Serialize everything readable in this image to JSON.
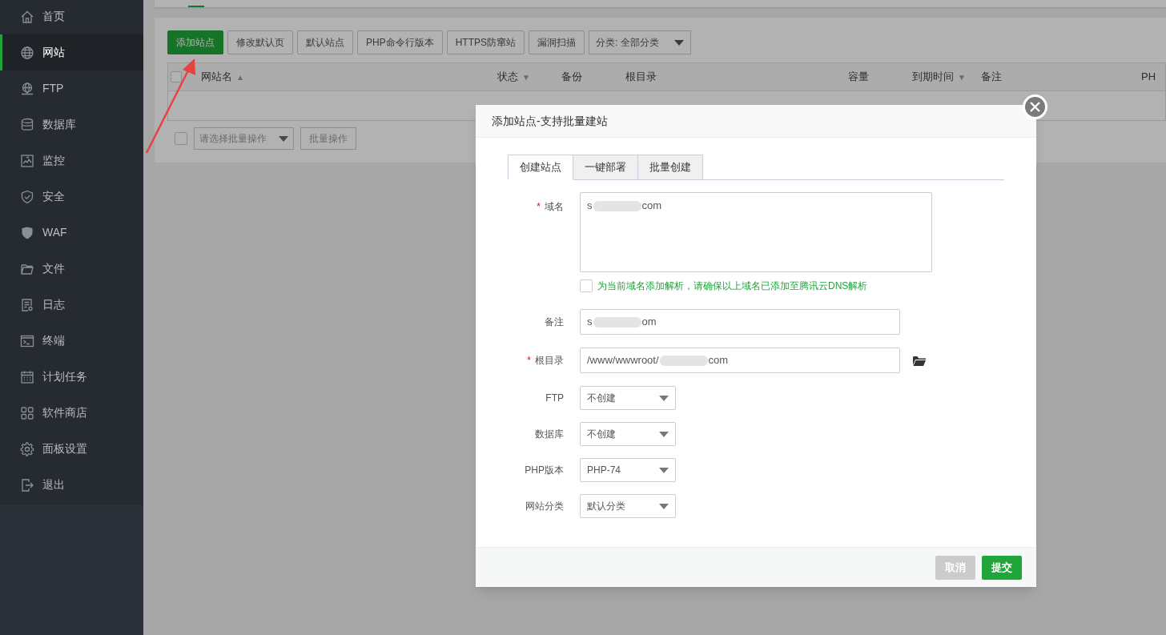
{
  "sidebar": {
    "items": [
      {
        "label": "首页",
        "selected": false
      },
      {
        "label": "网站",
        "selected": true
      },
      {
        "label": "FTP",
        "selected": false
      },
      {
        "label": "数据库",
        "selected": false
      },
      {
        "label": "监控",
        "selected": false
      },
      {
        "label": "安全",
        "selected": false
      },
      {
        "label": "WAF",
        "selected": false
      },
      {
        "label": "文件",
        "selected": false
      },
      {
        "label": "日志",
        "selected": false
      },
      {
        "label": "终端",
        "selected": false
      },
      {
        "label": "计划任务",
        "selected": false
      },
      {
        "label": "软件商店",
        "selected": false
      },
      {
        "label": "面板设置",
        "selected": false
      },
      {
        "label": "退出",
        "selected": false
      }
    ]
  },
  "toolbar": {
    "buttons": [
      {
        "label": "添加站点",
        "kind": "primary"
      },
      {
        "label": "修改默认页",
        "kind": "default"
      },
      {
        "label": "默认站点",
        "kind": "default"
      },
      {
        "label": "PHP命令行版本",
        "kind": "default"
      },
      {
        "label": "HTTPS防窜站",
        "kind": "default"
      },
      {
        "label": "漏洞扫描",
        "kind": "default"
      }
    ],
    "category_select": {
      "value": "分类: 全部分类"
    }
  },
  "table": {
    "select_all": {
      "checked": false
    },
    "columns": [
      {
        "label": "网站名",
        "sort": "▲"
      },
      {
        "label": "状态",
        "sort": "▼"
      },
      {
        "label": "备份"
      },
      {
        "label": "根目录"
      },
      {
        "label": "容量"
      },
      {
        "label": "到期时间",
        "sort": "▼"
      },
      {
        "label": "备注"
      },
      {
        "label": "PH"
      }
    ]
  },
  "batch": {
    "checked": false,
    "select_placeholder": "请选择批量操作",
    "button": "批量操作"
  },
  "modal": {
    "title": "添加站点-支持批量建站",
    "tabs": [
      {
        "label": "创建站点",
        "selected": true
      },
      {
        "label": "一键部署",
        "selected": false
      },
      {
        "label": "批量创建",
        "selected": false
      }
    ],
    "fields": [
      {
        "kind": "textarea",
        "label": "域名",
        "required_mark": "*",
        "value_start": "s",
        "value_end": "com"
      },
      {
        "kind": "checkbox",
        "label": "为当前域名添加解析，请确保以上域名已添加至腾讯云DNS解析",
        "checked": false
      },
      {
        "kind": "input",
        "label": "备注",
        "value_start": "s",
        "value_end": "om"
      },
      {
        "kind": "path",
        "label": "根目录",
        "required_mark": "*",
        "value_start": "/www/wwwroot/",
        "value_end": "com"
      },
      {
        "kind": "select",
        "label": "FTP",
        "value": "不创建"
      },
      {
        "kind": "select",
        "label": "数据库",
        "value": "不创建"
      },
      {
        "kind": "select",
        "label": "PHP版本",
        "value": "PHP-74"
      },
      {
        "kind": "select",
        "label": "网站分类",
        "value": "默认分类"
      }
    ],
    "buttons": [
      {
        "label": "取消",
        "kind": "cancel"
      },
      {
        "label": "提交",
        "kind": "primary"
      }
    ]
  }
}
